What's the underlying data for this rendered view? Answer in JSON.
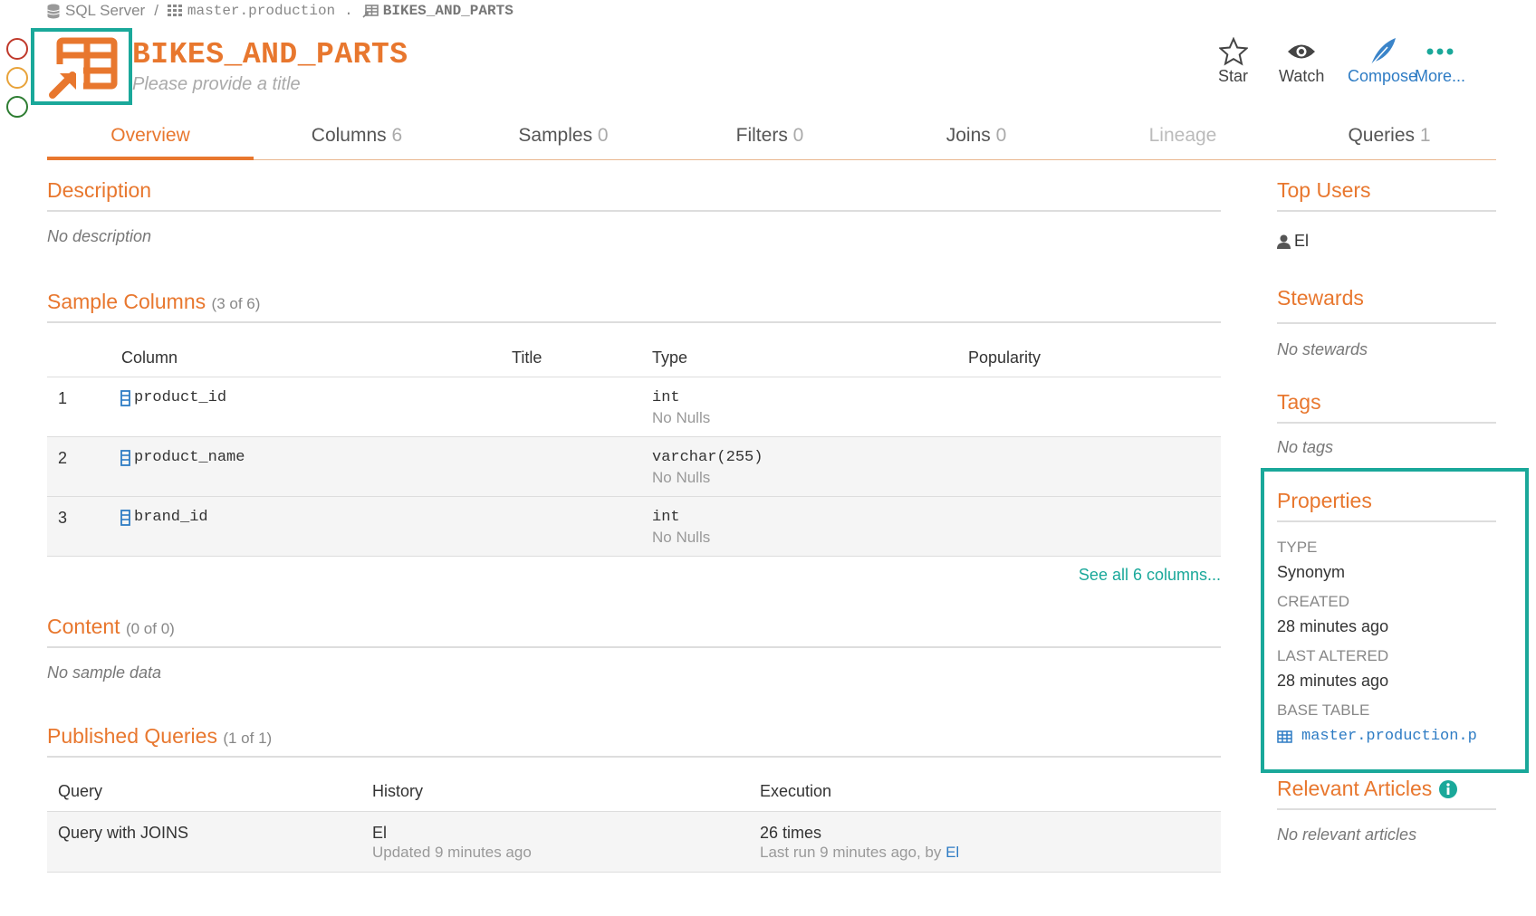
{
  "breadcrumb": {
    "server": "SQL Server",
    "separator": "/",
    "schema": "master.production",
    "dot": ".",
    "table": "BIKES_AND_PARTS"
  },
  "header": {
    "title": "BIKES_AND_PARTS",
    "subtitle_placeholder": "Please provide a title"
  },
  "actions": {
    "star": "Star",
    "watch": "Watch",
    "compose": "Compose",
    "more": "More..."
  },
  "tabs": [
    {
      "label": "Overview",
      "count": ""
    },
    {
      "label": "Columns",
      "count": "6"
    },
    {
      "label": "Samples",
      "count": "0"
    },
    {
      "label": "Filters",
      "count": "0"
    },
    {
      "label": "Joins",
      "count": "0"
    },
    {
      "label": "Lineage",
      "count": ""
    },
    {
      "label": "Queries",
      "count": "1"
    }
  ],
  "description": {
    "heading": "Description",
    "empty": "No description"
  },
  "sample_columns": {
    "heading": "Sample Columns",
    "sub": "(3 of 6)",
    "headers": {
      "column": "Column",
      "title": "Title",
      "type": "Type",
      "popularity": "Popularity"
    },
    "rows": [
      {
        "num": "1",
        "name": "product_id",
        "type": "int",
        "nulls": "No Nulls"
      },
      {
        "num": "2",
        "name": "product_name",
        "type": "varchar(255)",
        "nulls": "No Nulls"
      },
      {
        "num": "3",
        "name": "brand_id",
        "type": "int",
        "nulls": "No Nulls"
      }
    ],
    "see_all": "See all 6 columns..."
  },
  "content": {
    "heading": "Content",
    "sub": "(0 of 0)",
    "empty": "No sample data"
  },
  "published_queries": {
    "heading": "Published Queries",
    "sub": "(1 of 1)",
    "headers": {
      "query": "Query",
      "history": "History",
      "execution": "Execution"
    },
    "rows": [
      {
        "query": "Query with JOINS",
        "history_user": "El",
        "history_updated": "Updated 9 minutes ago",
        "exec_count": "26 times",
        "exec_last_prefix": "Last run 9 minutes ago, by",
        "exec_last_user": "El"
      }
    ]
  },
  "top_users": {
    "heading": "Top Users",
    "user": "El"
  },
  "stewards": {
    "heading": "Stewards",
    "empty": "No stewards"
  },
  "tags": {
    "heading": "Tags",
    "empty": "No tags"
  },
  "properties": {
    "heading": "Properties",
    "type_label": "TYPE",
    "type_value": "Synonym",
    "created_label": "CREATED",
    "created_value": "28 minutes ago",
    "altered_label": "LAST ALTERED",
    "altered_value": "28 minutes ago",
    "base_label": "BASE TABLE",
    "base_value": "master.production.p"
  },
  "relevant_articles": {
    "heading": "Relevant Articles",
    "empty": "No relevant articles"
  },
  "colors": {
    "accent": "#e8772e",
    "highlight": "#1aa89a",
    "link": "#2e7cc4"
  }
}
